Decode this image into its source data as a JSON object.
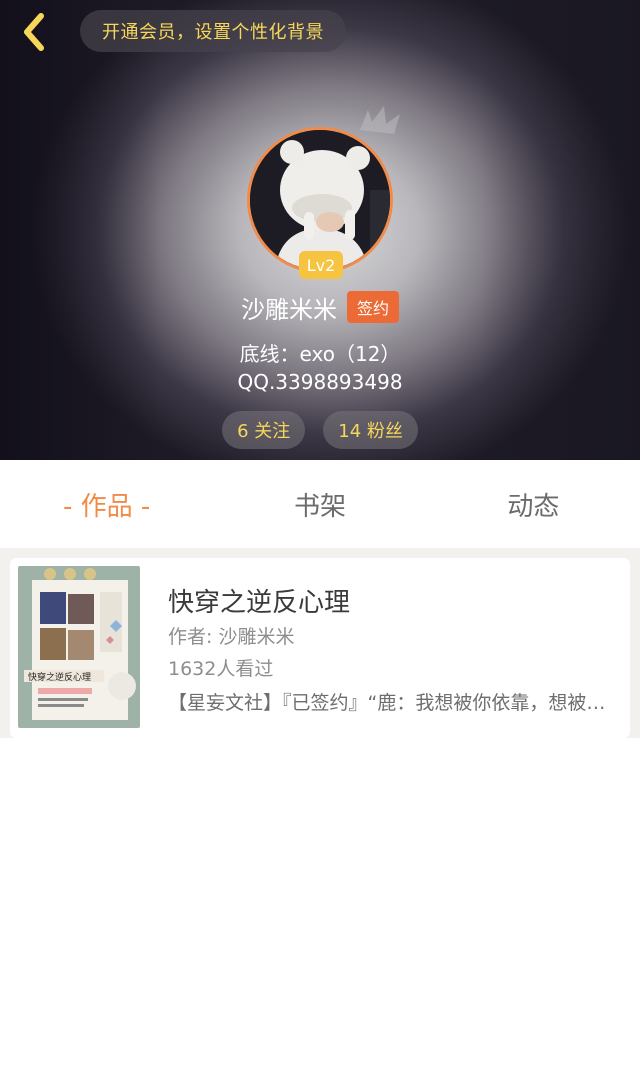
{
  "header": {
    "vip_banner": "开通会员，设置个性化背景",
    "level": "Lv2",
    "username": "沙雕米米",
    "sign_badge": "签约",
    "bio_line1": "底线：exo（12）",
    "bio_line2": "QQ.3398893498",
    "following": "6 关注",
    "followers": "14 粉丝"
  },
  "tabs": [
    {
      "label": "- 作品 -",
      "active": true
    },
    {
      "label": "书架",
      "active": false
    },
    {
      "label": "动态",
      "active": false
    }
  ],
  "books": [
    {
      "title": "快穿之逆反心理",
      "author": "作者: 沙雕米米",
      "views": "1632人看过",
      "description": "【星妄文社】『已签约』“鹿：我想被你依靠，想被你信任，想成为你的唯一。”",
      "cover_text": "快穿之逆反心理"
    }
  ],
  "colors": {
    "accent": "#f08b4a",
    "gold": "#f6d75a",
    "badge": "#ec6a36",
    "level": "#f6c440"
  }
}
